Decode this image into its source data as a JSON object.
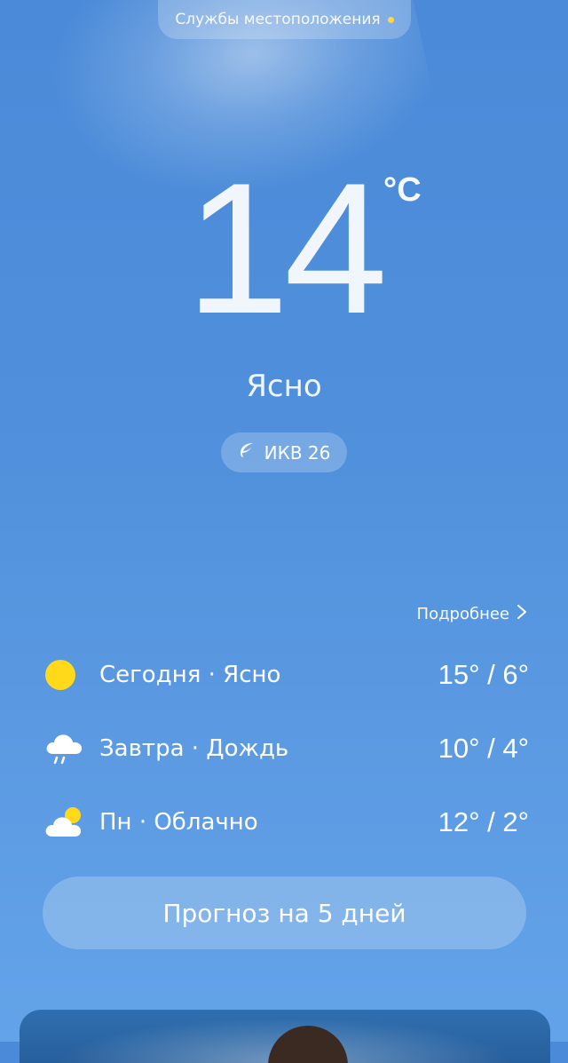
{
  "location": {
    "label": "Службы местоположения"
  },
  "current": {
    "temperature": "14",
    "unit": "°C",
    "condition": "Ясно",
    "aqi": "ИКВ 26"
  },
  "forecast": {
    "more_label": "Подробнее",
    "days": [
      {
        "label": "Сегодня · Ясно",
        "temps": "15° / 6°",
        "icon": "sun-icon"
      },
      {
        "label": "Завтра · Дождь",
        "temps": "10° / 4°",
        "icon": "rain-cloud-icon"
      },
      {
        "label": "Пн · Облачно",
        "temps": "12° / 2°",
        "icon": "partly-cloudy-icon"
      }
    ],
    "button_label": "Прогноз на 5 дней"
  },
  "colors": {
    "accent_dot": "#ffd84a",
    "sun": "#ffd91a",
    "background": "#4f8fdb"
  }
}
